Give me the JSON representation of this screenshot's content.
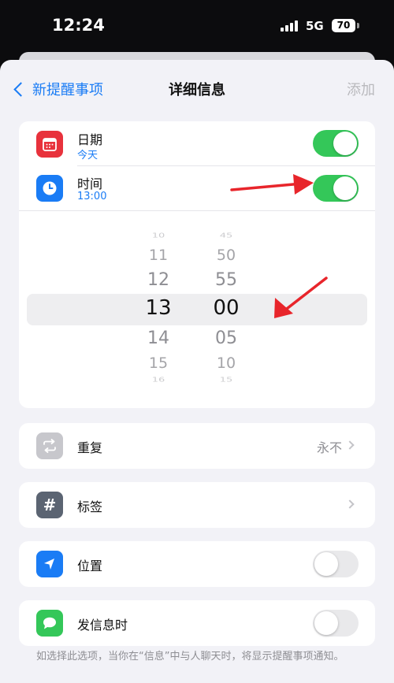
{
  "status": {
    "time": "12:24",
    "network": "5G",
    "battery": "70"
  },
  "nav": {
    "back": "新提醒事项",
    "title": "详细信息",
    "add": "添加"
  },
  "date_row": {
    "title": "日期",
    "subtitle": "今天",
    "toggle": "on"
  },
  "time_row": {
    "title": "时间",
    "subtitle": "13:00",
    "toggle": "on"
  },
  "picker": {
    "hours": [
      "10",
      "11",
      "12",
      "13",
      "14",
      "15",
      "16"
    ],
    "minutes": [
      "45",
      "50",
      "55",
      "00",
      "05",
      "10",
      "15"
    ],
    "selected_hour": "13",
    "selected_minute": "00"
  },
  "repeat_row": {
    "title": "重复",
    "value": "永不"
  },
  "tag_row": {
    "title": "标签"
  },
  "location_row": {
    "title": "位置",
    "toggle": "off"
  },
  "message_row": {
    "title": "发信息时",
    "toggle": "off"
  },
  "footnote": "如选择此选项，当你在“信息”中与人聊天时，将显示提醒事项通知。",
  "colors": {
    "accent": "#1a7cf5",
    "toggle_on": "#34c759",
    "calendar_icon": "#e8323c",
    "clock_icon": "#1a7cf5",
    "repeat_icon": "#b9b9be",
    "tag_icon": "#5b6472",
    "location_icon": "#1a7cf5",
    "message_icon": "#34c759",
    "annotation_arrow": "#e8252b"
  }
}
